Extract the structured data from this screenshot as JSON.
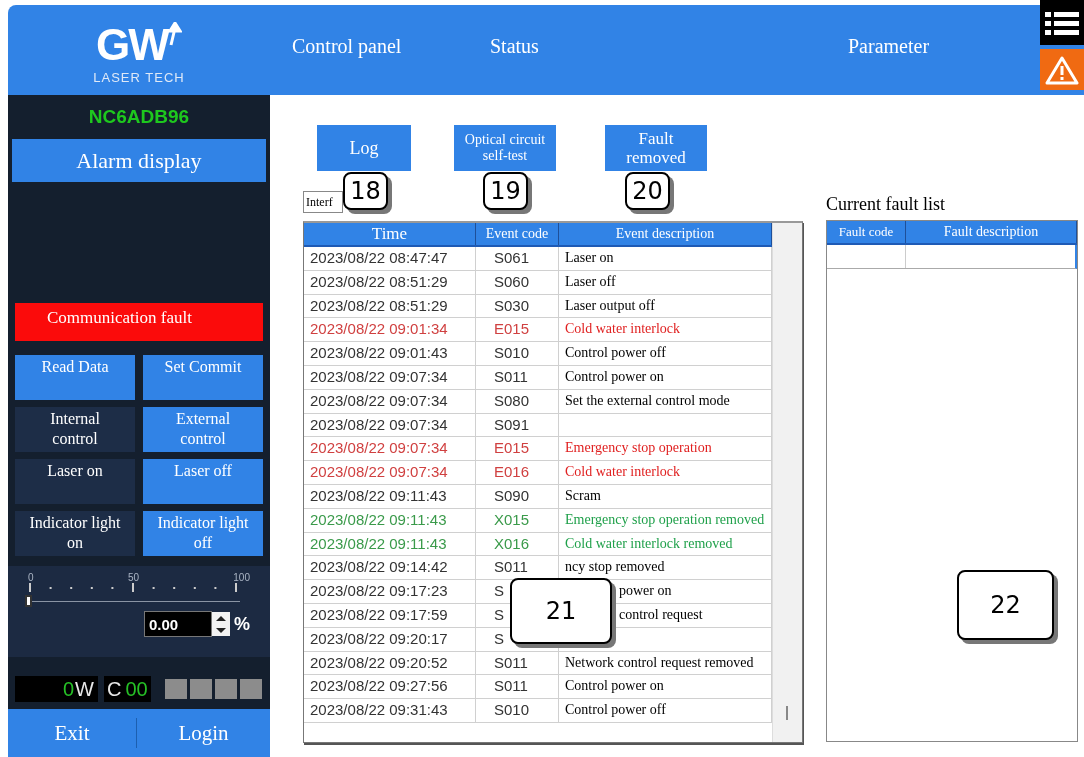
{
  "header": {
    "logo": {
      "mark": "GW",
      "tagline": "LASER TECH"
    },
    "nav": [
      "Control panel",
      "Status",
      "Parameter"
    ]
  },
  "sidebar": {
    "device_id": "NC6ADB96",
    "alarm_button": "Alarm display",
    "fault_banner": "Communication fault",
    "controls": [
      {
        "label": "Read Data",
        "active": true
      },
      {
        "label": "Set Commit",
        "active": true
      },
      {
        "label": "Internal control",
        "active": false
      },
      {
        "label": "External control",
        "active": true
      },
      {
        "label": "Laser on",
        "active": false
      },
      {
        "label": "Laser off",
        "active": true
      },
      {
        "label": "Indicator light on",
        "active": false
      },
      {
        "label": "Indicator light off",
        "active": true
      }
    ],
    "power": {
      "scale": [
        "0",
        "50",
        "100"
      ],
      "level": 0,
      "value": "0.00",
      "unit": "%"
    },
    "status": {
      "power_value": "0",
      "power_unit": "W",
      "channel_label": "C",
      "channel_value": "00"
    },
    "footer": [
      "Exit",
      "Login"
    ]
  },
  "actions": [
    "Log",
    "Optical circuit self-test",
    "Fault removed"
  ],
  "filter": {
    "value": "Interf"
  },
  "event_log": {
    "columns": [
      "Time",
      "Event code",
      "Event description"
    ],
    "rows": [
      {
        "time": "2023/08/22  08:47:47",
        "code": "S061",
        "description": "Laser on",
        "kind": "event"
      },
      {
        "time": "2023/08/22  08:51:29",
        "code": "S060",
        "description": "Laser off",
        "kind": "event"
      },
      {
        "time": "2023/08/22  08:51:29",
        "code": "S030",
        "description": "Laser output off",
        "kind": "event"
      },
      {
        "time": "2023/08/22  09:01:34",
        "code": "E015",
        "description": "Cold water interlock",
        "kind": "fault"
      },
      {
        "time": "2023/08/22  09:01:43",
        "code": "S010",
        "description": "Control power off",
        "kind": "event"
      },
      {
        "time": "2023/08/22  09:07:34",
        "code": "S011",
        "description": "Control power on",
        "kind": "event"
      },
      {
        "time": "2023/08/22  09:07:34",
        "code": "S080",
        "description": "Set the external control mode",
        "kind": "event"
      },
      {
        "time": "2023/08/22  09:07:34",
        "code": "S091",
        "kind": "event"
      },
      {
        "time": "2023/08/22  09:07:34",
        "code": "E015",
        "description": "Emergency stop operation",
        "kind": "fault"
      },
      {
        "time": "2023/08/22  09:07:34",
        "code": "E016",
        "description": "Cold water interlock",
        "kind": "fault"
      },
      {
        "time": "2023/08/22  09:11:43",
        "code": "S090",
        "description": "Scram",
        "kind": "event"
      },
      {
        "time": "2023/08/22  09:11:43",
        "code": "X015",
        "description": "Emergency stop operation removed",
        "kind": "cleared"
      },
      {
        "time": "2023/08/22  09:11:43",
        "code": "X016",
        "description": "Cold water interlock removed",
        "kind": "cleared"
      },
      {
        "time": "2023/08/22  09:14:42",
        "code": "S011",
        "description": "ncy stop removed",
        "kind": "event"
      },
      {
        "time": "2023/08/22  09:17:23",
        "code": "S",
        "description": "power on",
        "clipped": true,
        "kind": "event"
      },
      {
        "time": "2023/08/22  09:17:59",
        "code": "S",
        "description": "control request",
        "clipped": true,
        "kind": "event"
      },
      {
        "time": "2023/08/22  09:20:17",
        "code": "S",
        "kind": "event"
      },
      {
        "time": "2023/08/22  09:20:52",
        "code": "S011",
        "description": "Network control request removed",
        "kind": "event"
      },
      {
        "time": "2023/08/22  09:27:56",
        "code": "S011",
        "description": "Control power on",
        "kind": "event"
      },
      {
        "time": "2023/08/22  09:31:43",
        "code": "S010",
        "description": "Control power off",
        "kind": "event"
      }
    ]
  },
  "fault_list": {
    "title": "Current fault list",
    "columns": [
      "Fault code",
      "Fault description"
    ]
  },
  "callouts": [
    "18",
    "19",
    "20",
    "21",
    "22"
  ]
}
